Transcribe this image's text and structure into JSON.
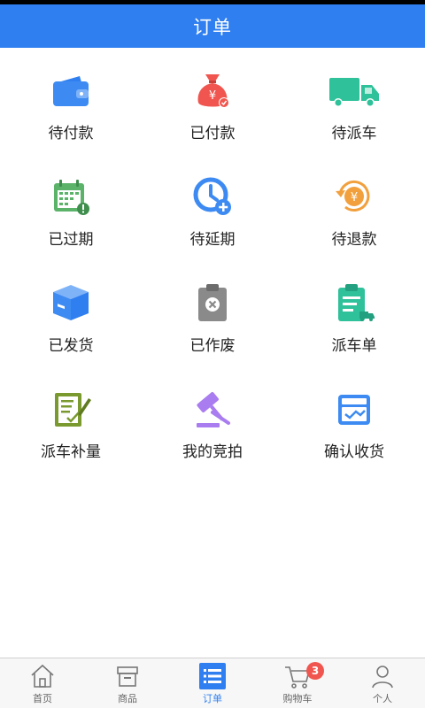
{
  "header": {
    "title": "订单"
  },
  "colors": {
    "accent": "#2f7ff0",
    "badge": "#f0564f"
  },
  "grid": [
    {
      "label": "待付款",
      "icon": "wallet-icon"
    },
    {
      "label": "已付款",
      "icon": "money-bag-icon"
    },
    {
      "label": "待派车",
      "icon": "truck-icon"
    },
    {
      "label": "已过期",
      "icon": "calendar-alert-icon"
    },
    {
      "label": "待延期",
      "icon": "clock-plus-icon"
    },
    {
      "label": "待退款",
      "icon": "refund-coin-icon"
    },
    {
      "label": "已发货",
      "icon": "box-icon"
    },
    {
      "label": "已作废",
      "icon": "clipboard-cancel-icon"
    },
    {
      "label": "派车单",
      "icon": "clipboard-truck-icon"
    },
    {
      "label": "派车补量",
      "icon": "document-edit-icon"
    },
    {
      "label": "我的竞拍",
      "icon": "auction-gavel-icon"
    },
    {
      "label": "确认收货",
      "icon": "receive-box-icon"
    }
  ],
  "tabbar": {
    "items": [
      {
        "label": "首页",
        "icon": "home-icon"
      },
      {
        "label": "商品",
        "icon": "archive-box-icon"
      },
      {
        "label": "订单",
        "icon": "list-icon"
      },
      {
        "label": "购物车",
        "icon": "cart-icon",
        "badge": "3"
      },
      {
        "label": "个人",
        "icon": "user-icon"
      }
    ],
    "active_index": 2
  }
}
